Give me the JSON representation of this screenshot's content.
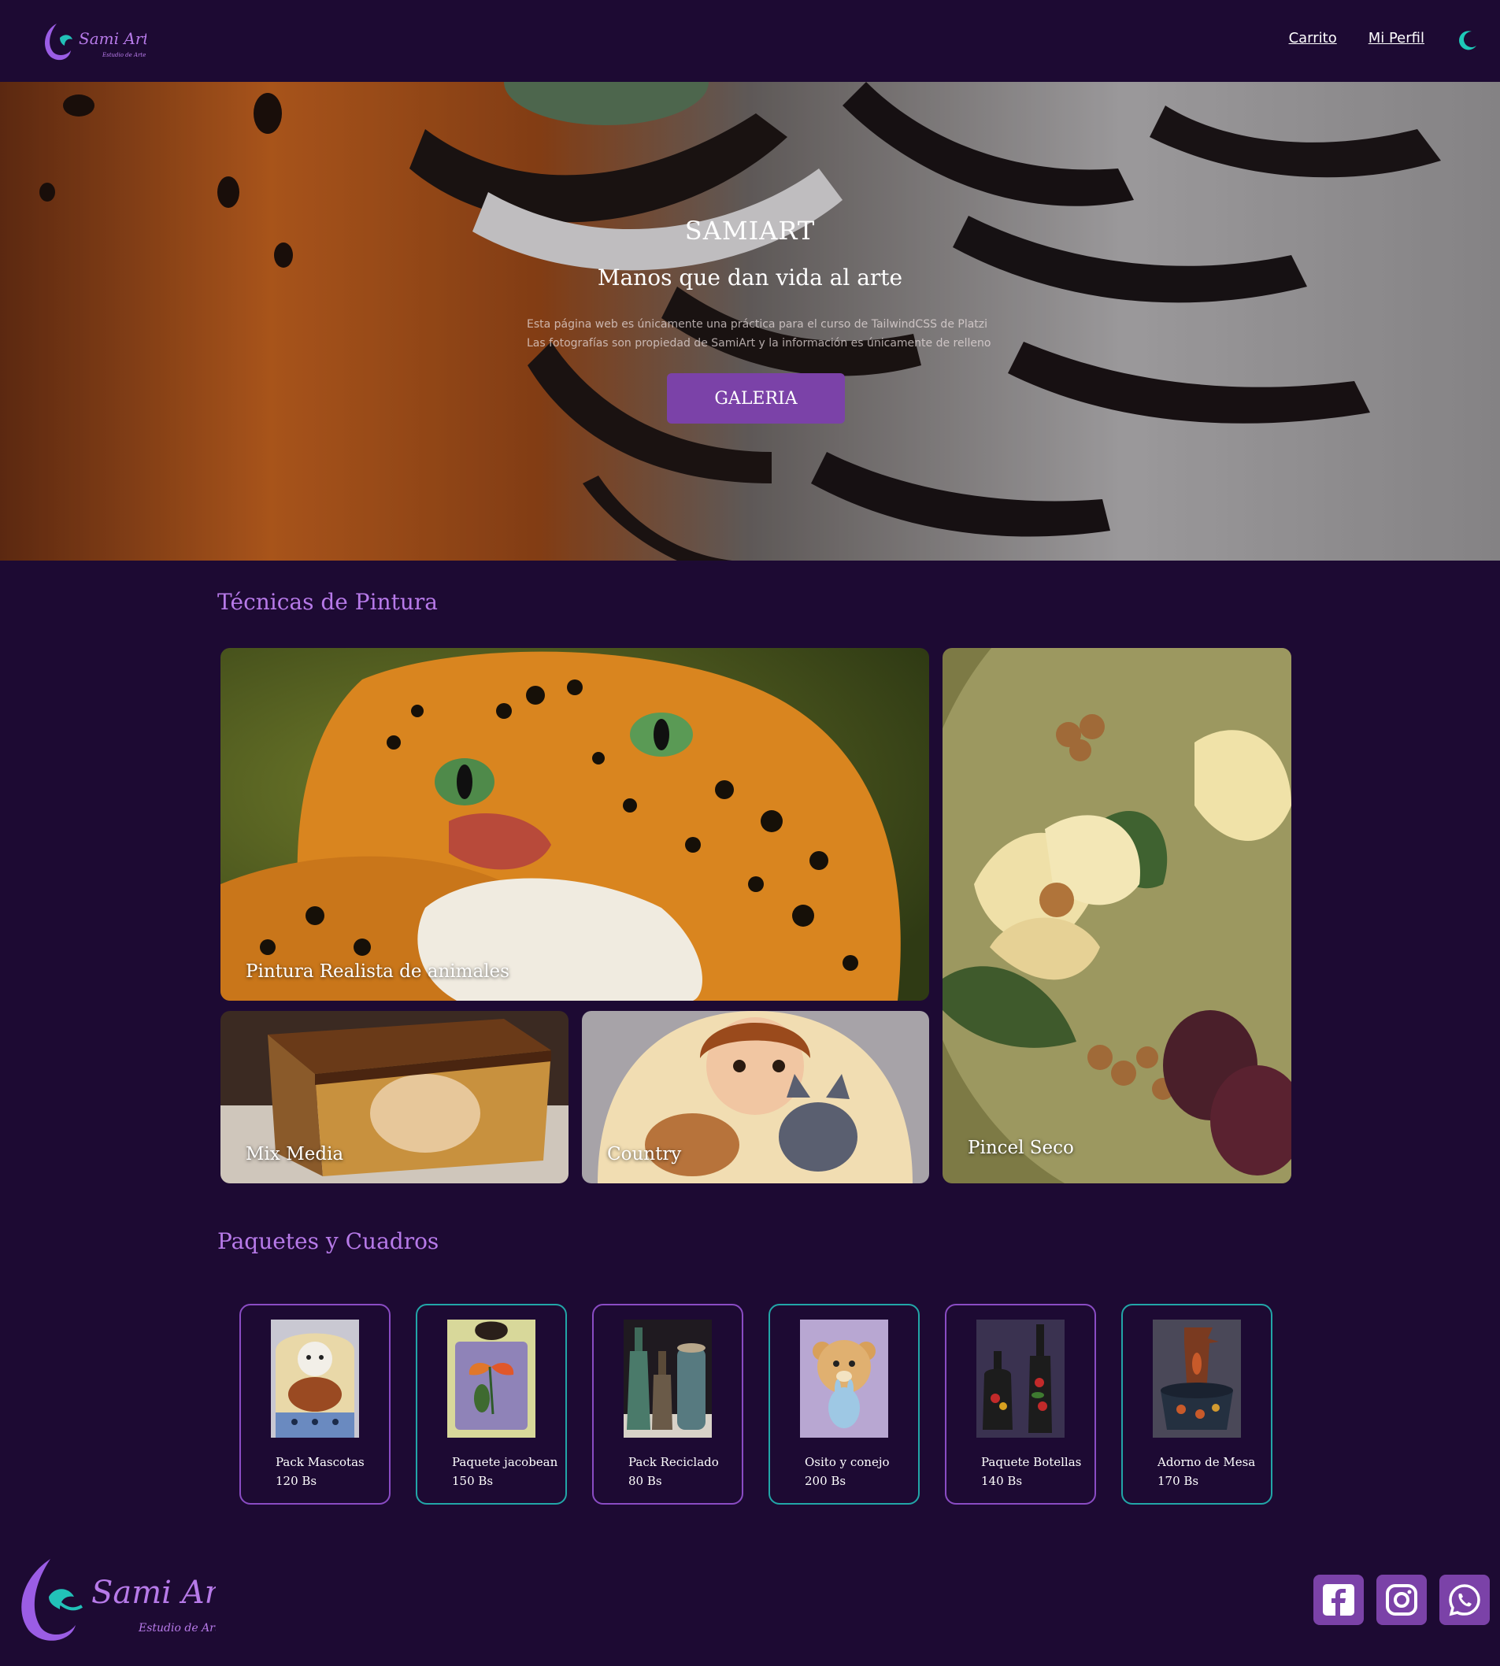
{
  "brand": {
    "logo_text": "Sami Art",
    "logo_sub": "Estudio de Arte"
  },
  "nav": {
    "links": [
      "Carrito",
      "Mi Perfil"
    ],
    "theme_icon": "moon-icon"
  },
  "hero": {
    "title": "SAMIART",
    "subtitle": "Manos que dan vida al arte",
    "note_line1": "Esta página web es únicamente una práctica para el curso de TailwindCSS de Platzi",
    "note_line2": "Las fotografías son propiedad de SamiArt y la información es únicamente de relleno",
    "button": "GALERIA"
  },
  "techniques": {
    "title": "Técnicas de Pintura",
    "items": [
      {
        "label": "Pintura Realista de animales"
      },
      {
        "label": "Mix Media"
      },
      {
        "label": "Country"
      },
      {
        "label": "Pincel Seco"
      }
    ]
  },
  "packages": {
    "title": "Paquetes y Cuadros",
    "items": [
      {
        "name": "Pack Mascotas",
        "price": "120 Bs"
      },
      {
        "name": "Paquete jacobean",
        "price": "150 Bs"
      },
      {
        "name": "Pack Reciclado",
        "price": "80 Bs"
      },
      {
        "name": "Osito y conejo",
        "price": "200 Bs"
      },
      {
        "name": "Paquete Botellas",
        "price": "140 Bs"
      },
      {
        "name": "Adorno de Mesa",
        "price": "170 Bs"
      }
    ]
  },
  "footer": {
    "social": [
      "facebook-icon",
      "instagram-icon",
      "whatsapp-icon"
    ]
  },
  "colors": {
    "background": "#1d0a33",
    "accent_purple": "#7b42a8",
    "title_purple": "#b77ae9",
    "accent_teal": "#22a6a8"
  }
}
